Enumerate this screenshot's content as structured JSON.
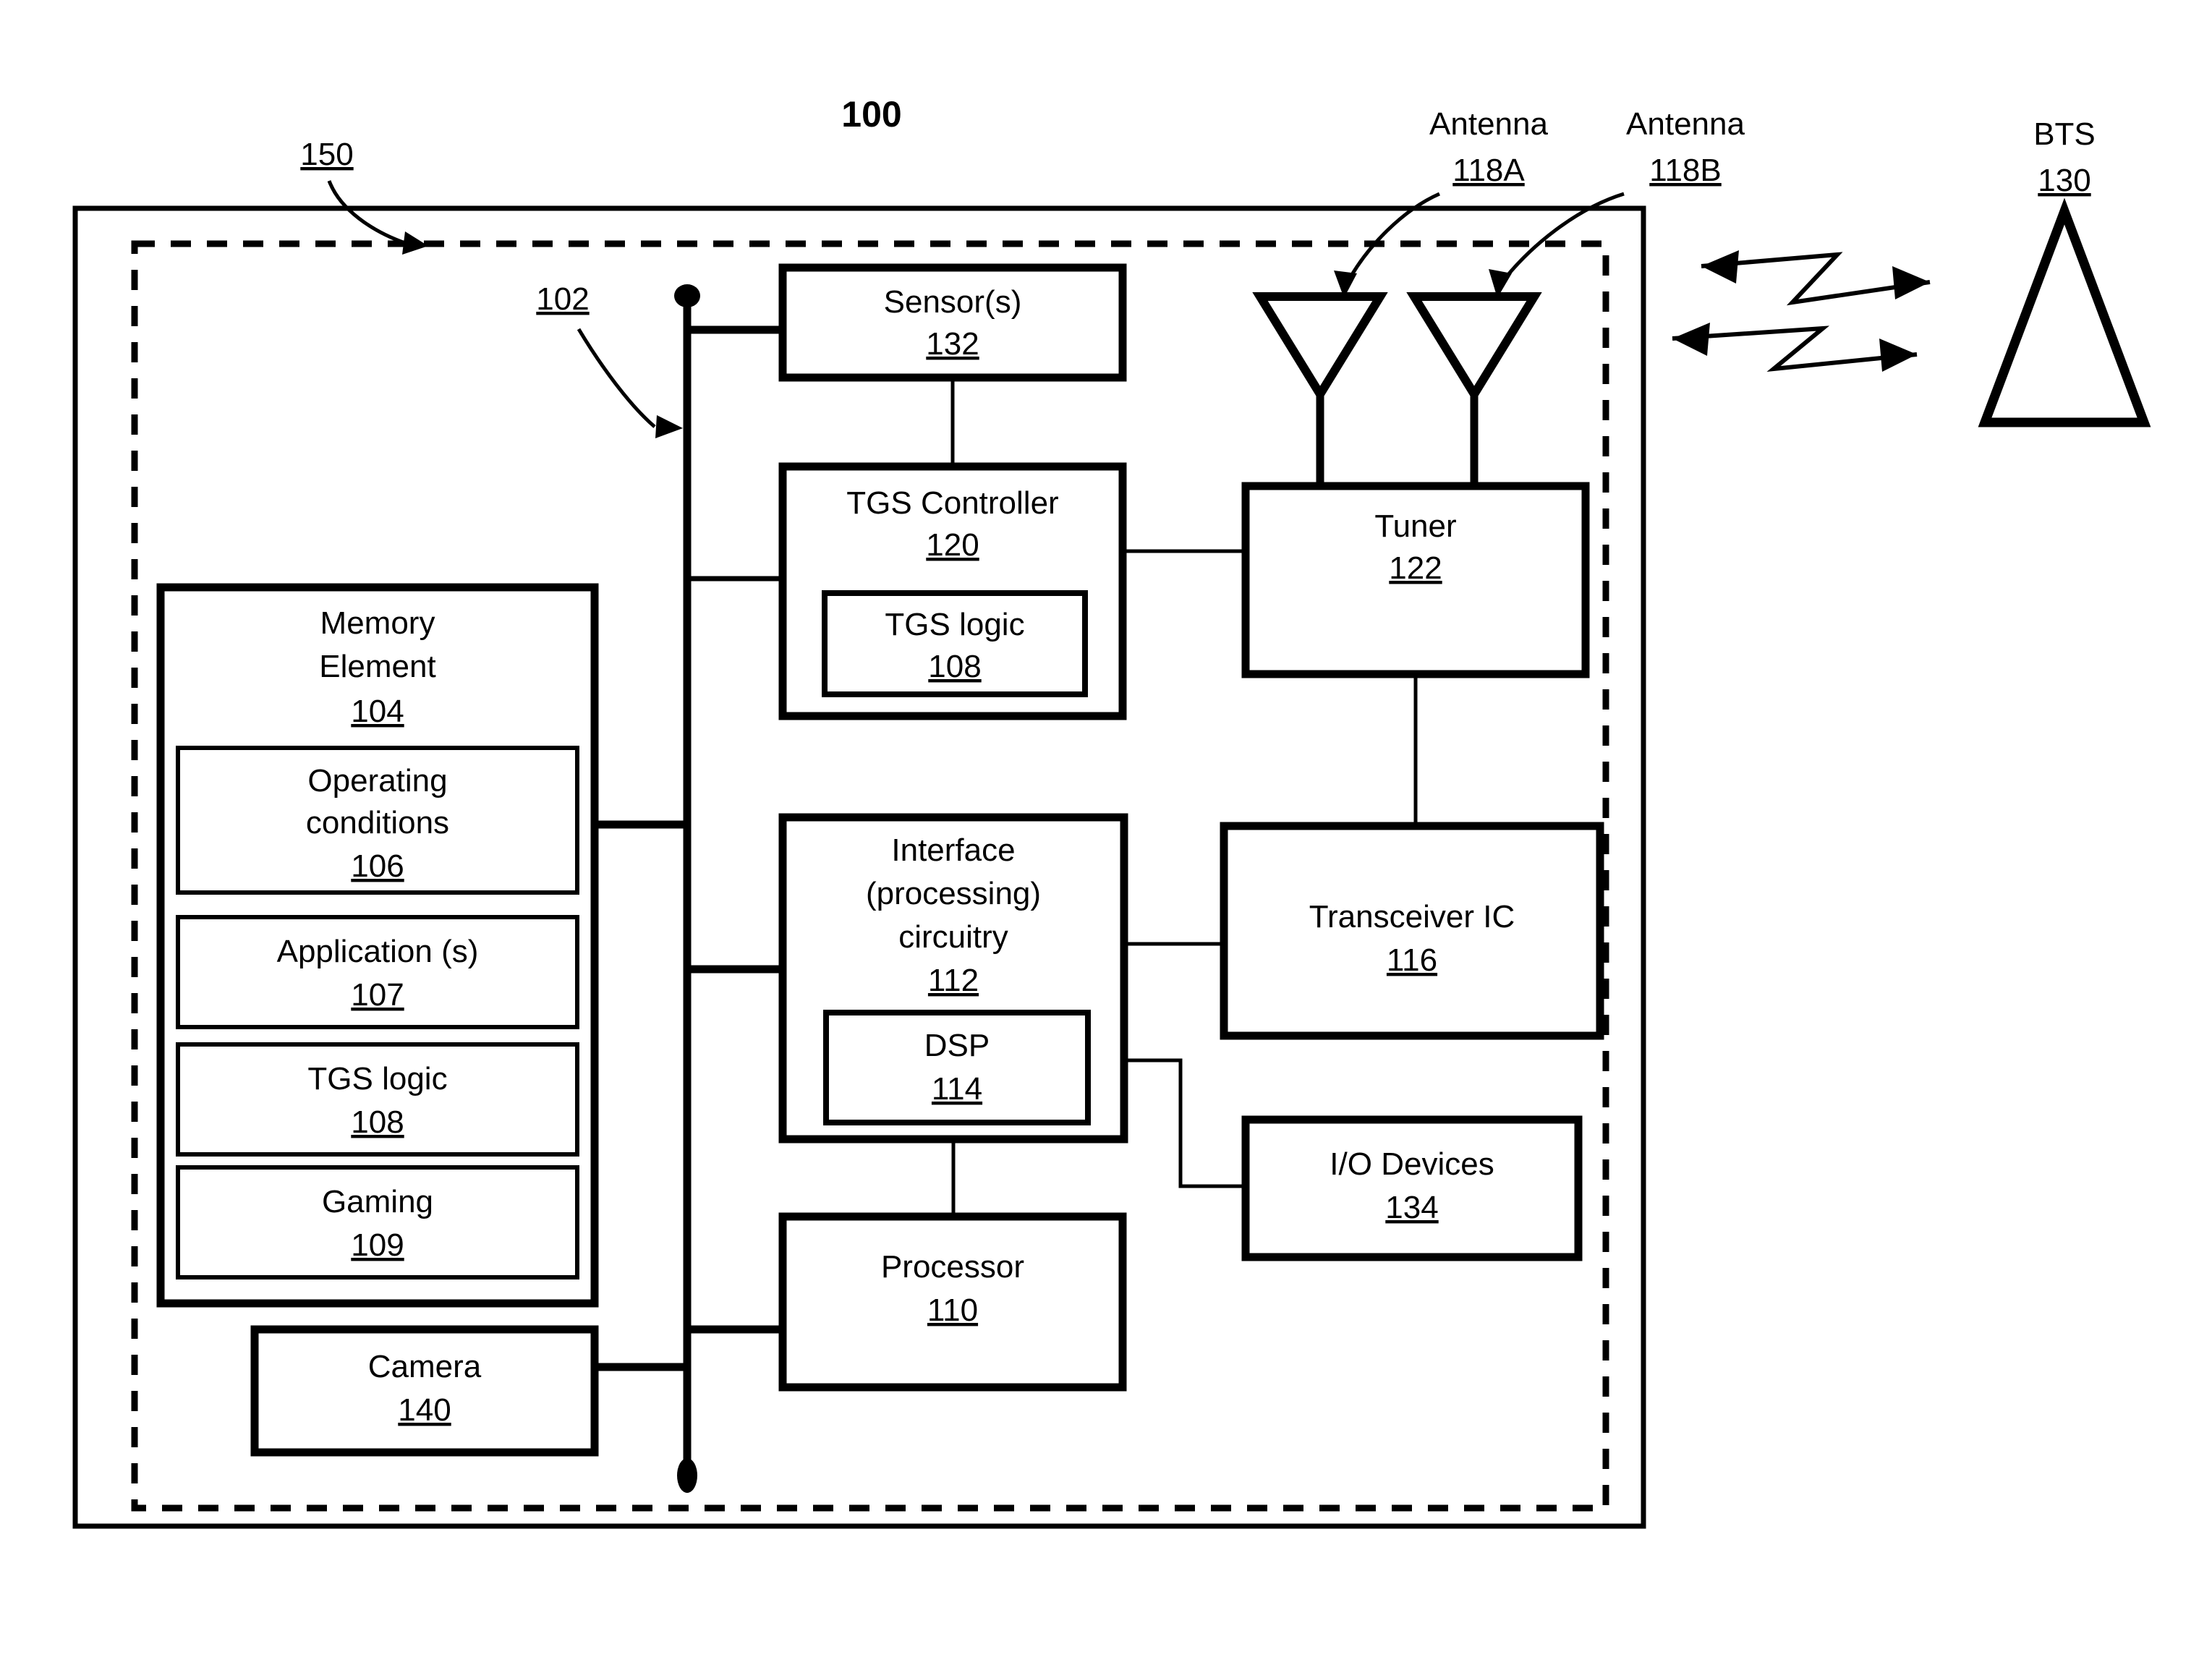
{
  "figure": {
    "title": "100",
    "device_outer_ref": "150",
    "bus_ref": "102"
  },
  "blocks": {
    "sensors": {
      "label": "Sensor(s)",
      "ref": "132"
    },
    "tgs_controller": {
      "label": "TGS Controller",
      "ref": "120"
    },
    "tgs_logic_ctrl": {
      "label": "TGS logic",
      "ref": "108"
    },
    "memory": {
      "label_line1": "Memory",
      "label_line2": "Element",
      "ref": "104"
    },
    "operating_conditions": {
      "label_line1": "Operating",
      "label_line2": "conditions",
      "ref": "106"
    },
    "applications": {
      "label": "Application (s)",
      "ref": "107"
    },
    "tgs_logic_mem": {
      "label": "TGS logic",
      "ref": "108"
    },
    "gaming": {
      "label": "Gaming",
      "ref": "109"
    },
    "camera": {
      "label": "Camera",
      "ref": "140"
    },
    "interface": {
      "label_line1": "Interface",
      "label_line2": "(processing)",
      "label_line3": "circuitry",
      "ref": "112"
    },
    "dsp": {
      "label": "DSP",
      "ref": "114"
    },
    "processor": {
      "label": "Processor",
      "ref": "110"
    },
    "tuner": {
      "label": "Tuner",
      "ref": "122"
    },
    "transceiver": {
      "label": "Transceiver IC",
      "ref": "116"
    },
    "io_devices": {
      "label": "I/O Devices",
      "ref": "134"
    }
  },
  "antennas": [
    {
      "label": "Antenna",
      "ref": "118A"
    },
    {
      "label": "Antenna",
      "ref": "118B"
    }
  ],
  "bts": {
    "label": "BTS",
    "ref": "130"
  },
  "colors": {
    "ink": "#000000",
    "paper": "#ffffff"
  }
}
